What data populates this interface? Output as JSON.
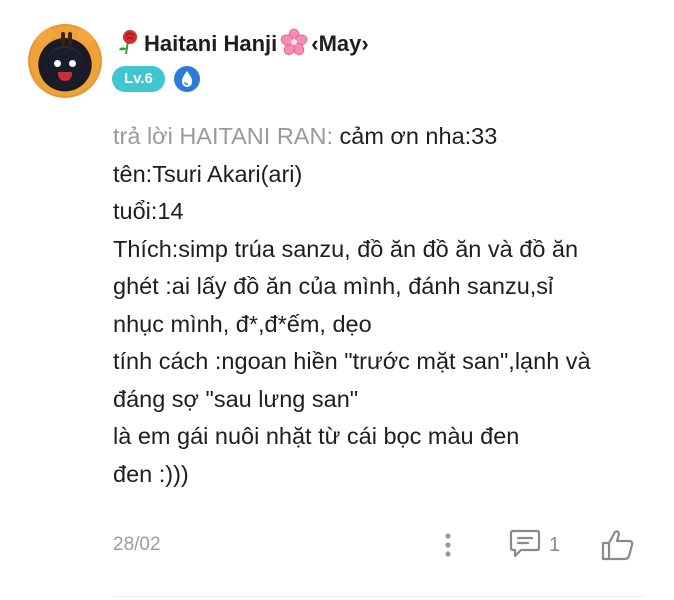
{
  "comment": {
    "author": {
      "prefix_icon": "rose-icon",
      "name": "Haitani Hanji",
      "suffix_icon": "cherry-blossom-icon",
      "tag": "‹May›",
      "level": "Lv.6",
      "badge_icon": "water-drop-badge-icon"
    },
    "reply_prefix": "trả lời HAITANI RAN:",
    "lines": [
      "cảm ơn nha:33",
      "tên:Tsuri Akari(ari)",
      "tuổi:14",
      "Thích:simp trúa sanzu, đồ ăn đồ ăn và đồ ăn",
      "ghét :ai lấy đồ ăn của mình, đánh sanzu,sỉ",
      "nhục mình, đ*,đ*ếm, dẹo",
      "tính cách :ngoan hiền \"trước mặt san\",lạnh và",
      "đáng sợ \"sau lưng san\"",
      "là em gái nuôi nhặt từ cái bọc màu đen",
      "đen :)))"
    ],
    "date": "28/02",
    "reply_count": "1",
    "colors": {
      "level_badge": "#3fc6cf",
      "drop_badge": "#2d7bd8",
      "muted_text": "#9a9a9a"
    }
  }
}
